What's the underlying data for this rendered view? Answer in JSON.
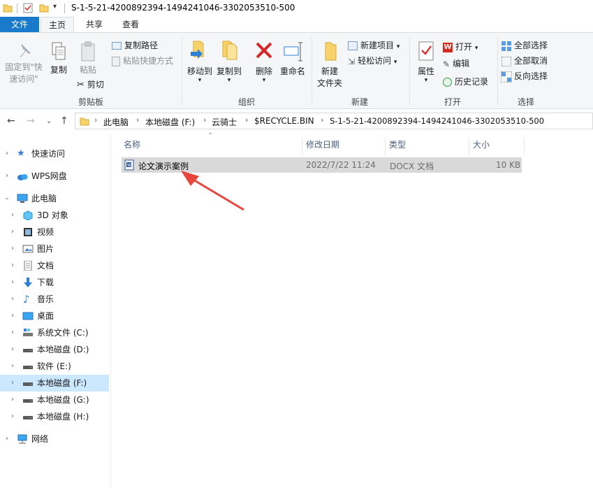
{
  "window": {
    "title": "S-1-5-21-4200892394-1494241046-3302053510-500"
  },
  "tabs": [
    {
      "label": "文件"
    },
    {
      "label": "主页"
    },
    {
      "label": "共享"
    },
    {
      "label": "查看"
    }
  ],
  "ribbon": {
    "clipboard": {
      "pin_label_1": "固定到\"快",
      "pin_label_2": "速访问\"",
      "copy_label": "复制",
      "paste_label": "粘贴",
      "copy_path_label": "复制路径",
      "paste_shortcut_label": "粘贴快捷方式",
      "cut_label": "剪切",
      "group_label": "剪贴板"
    },
    "organize": {
      "move_to_label": "移动到",
      "copy_to_label": "复制到",
      "delete_label": "删除",
      "rename_label": "重命名",
      "group_label": "组织"
    },
    "new": {
      "new_folder_label_1": "新建",
      "new_folder_label_2": "文件夹",
      "new_item_label": "新建项目",
      "easy_access_label": "轻松访问",
      "group_label": "新建"
    },
    "open": {
      "properties_label": "属性",
      "open_label": "打开",
      "edit_label": "编辑",
      "history_label": "历史记录",
      "group_label": "打开"
    },
    "select": {
      "select_all_label": "全部选择",
      "select_none_label": "全部取消",
      "invert_label": "反向选择",
      "group_label": "选择"
    }
  },
  "address": {
    "crumbs": [
      "此电脑",
      "本地磁盘 (F:)",
      "云骑士",
      "$RECYCLE.BIN",
      "S-1-5-21-4200892394-1494241046-3302053510-500"
    ]
  },
  "nav_tree": [
    {
      "label": "快速访问",
      "icon": "star-icon"
    },
    {
      "label": "WPS网盘",
      "icon": "cloud-icon"
    },
    {
      "label": "此电脑",
      "icon": "computer-icon"
    },
    {
      "label": "3D 对象",
      "icon": "cube-icon"
    },
    {
      "label": "视频",
      "icon": "video-icon"
    },
    {
      "label": "图片",
      "icon": "picture-icon"
    },
    {
      "label": "文档",
      "icon": "document-icon"
    },
    {
      "label": "下载",
      "icon": "download-icon"
    },
    {
      "label": "音乐",
      "icon": "music-icon"
    },
    {
      "label": "桌面",
      "icon": "desktop-icon"
    },
    {
      "label": "系统文件 (C:)",
      "icon": "system-drive-icon"
    },
    {
      "label": "本地磁盘 (D:)",
      "icon": "drive-icon"
    },
    {
      "label": "软件 (E:)",
      "icon": "drive-icon"
    },
    {
      "label": "本地磁盘 (F:)",
      "icon": "drive-icon"
    },
    {
      "label": "本地磁盘 (G:)",
      "icon": "drive-icon"
    },
    {
      "label": "本地磁盘 (H:)",
      "icon": "drive-icon"
    },
    {
      "label": "网络",
      "icon": "network-icon"
    }
  ],
  "columns": {
    "name": "名称",
    "modified": "修改日期",
    "type": "类型",
    "size": "大小"
  },
  "files": [
    {
      "name": "论文演示案例",
      "modified": "2022/7/22 11:24",
      "type": "DOCX 文档",
      "size": "10 KB"
    }
  ],
  "colors": {
    "file_tab": "#1979ca",
    "selected_nav": "#cce8ff",
    "selected_row": "#d9d9d9",
    "arrow": "#e8453c"
  }
}
